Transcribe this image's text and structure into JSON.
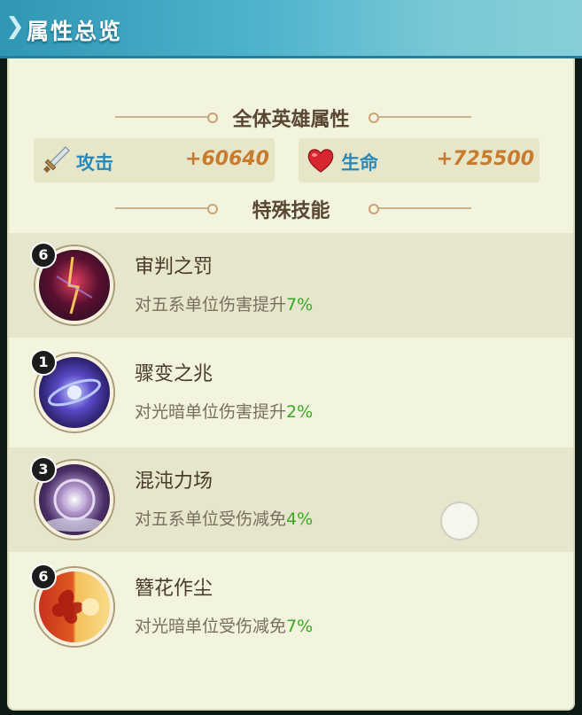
{
  "header": {
    "title": "属性总览"
  },
  "hero_attributes": {
    "section_title": "全体英雄属性",
    "attack": {
      "label": "攻击",
      "value": "+60640",
      "icon": "sword-icon"
    },
    "hp": {
      "label": "生命",
      "value": "+725500",
      "icon": "heart-icon"
    }
  },
  "skills_section": {
    "title": "特殊技能"
  },
  "skills": [
    {
      "level": "6",
      "name": "审判之罚",
      "desc_text": "对五系单位伤害提升",
      "pct": "7%",
      "icon": "judgement-skill-icon",
      "accent": "#8b1f3a"
    },
    {
      "level": "1",
      "name": "骤变之兆",
      "desc_text": "对光暗单位伤害提升",
      "pct": "2%",
      "icon": "omen-skill-icon",
      "accent": "#4a3aa8"
    },
    {
      "level": "3",
      "name": "混沌力场",
      "desc_text": "对五系单位受伤减免",
      "pct": "4%",
      "icon": "chaos-field-skill-icon",
      "accent": "#6a4a8a"
    },
    {
      "level": "6",
      "name": "簪花作尘",
      "desc_text": "对光暗单位受伤减免",
      "pct": "7%",
      "icon": "flower-dust-skill-icon",
      "accent": "#d47a24"
    }
  ],
  "colors": {
    "header": "#4fb3cc",
    "label_blue": "#2a89b8",
    "value_orange": "#c77b2e",
    "pct_green": "#3aa824"
  }
}
